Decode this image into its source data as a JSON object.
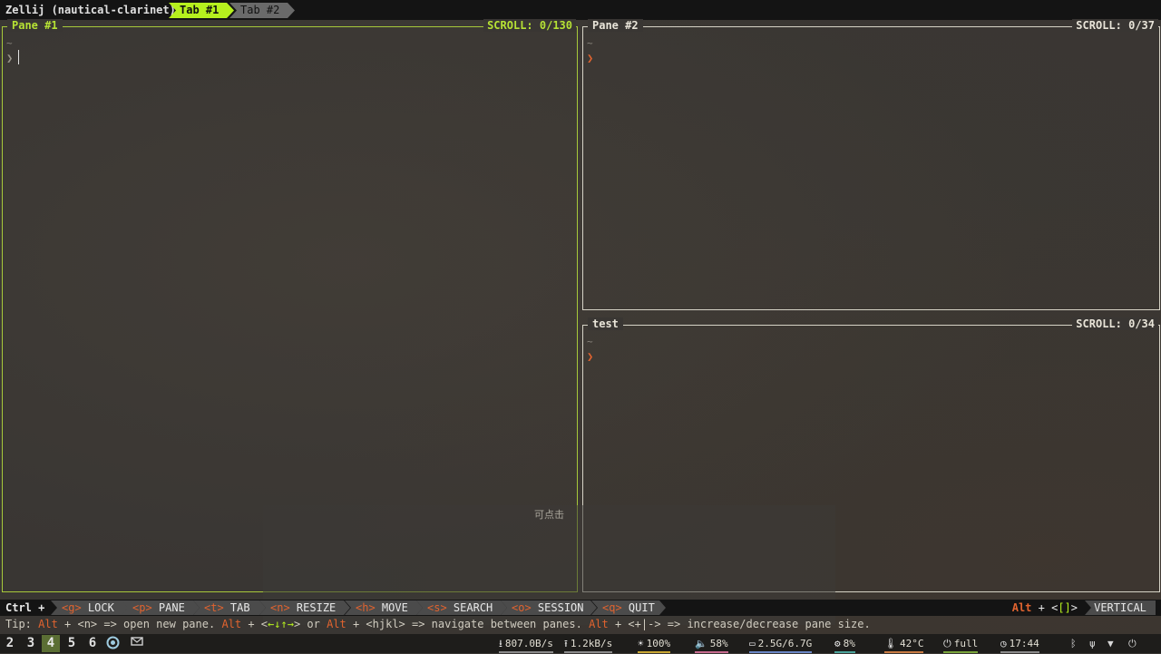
{
  "tabbar": {
    "session_title": "Zellij (nautical-clarinet)",
    "tabs": [
      {
        "label": "Tab #1",
        "active": true
      },
      {
        "label": "Tab #2",
        "active": false
      }
    ]
  },
  "panes": [
    {
      "title": "Pane #1",
      "scroll": "SCROLL:  0/130",
      "cwd": "~",
      "prompt": "❯",
      "focused": true
    },
    {
      "title": "Pane #2",
      "scroll": "SCROLL:  0/37",
      "cwd": "~",
      "prompt": "❯",
      "focused": false
    },
    {
      "title": "test",
      "scroll": "SCROLL:  0/34",
      "cwd": "~",
      "prompt": "❯",
      "focused": false
    }
  ],
  "overlay": {
    "label": "可点击"
  },
  "keybar": {
    "prefix": "Ctrl +",
    "items": [
      {
        "key": "<g>",
        "label": "LOCK"
      },
      {
        "key": "<p>",
        "label": "PANE"
      },
      {
        "key": "<t>",
        "label": "TAB"
      },
      {
        "key": "<n>",
        "label": "RESIZE"
      },
      {
        "key": "<h>",
        "label": "MOVE"
      },
      {
        "key": "<s>",
        "label": "SEARCH"
      },
      {
        "key": "<o>",
        "label": "SESSION"
      },
      {
        "key": "<q>",
        "label": "QUIT"
      }
    ],
    "right_alt": "Alt",
    "right_plus": " + <",
    "right_brackets": "[]",
    "right_close": ">",
    "mode": "VERTICAL"
  },
  "tip": {
    "p1": "Tip: ",
    "alt1": "Alt",
    "p2": " + <n> => open new pane. ",
    "alt2": "Alt",
    "p3": " + <",
    "arrows": "←↓↑→",
    "p4": "> or ",
    "alt3": "Alt",
    "p5": " + <hjkl> => navigate between panes. ",
    "alt4": "Alt",
    "p6": " + <+|-> => increase/decrease pane size."
  },
  "statusbar": {
    "workspaces": [
      "2",
      "3",
      "4",
      "5",
      "6"
    ],
    "active_workspace": "4",
    "download": "807.0B/s",
    "upload": "1.2kB/s",
    "brightness": "100%",
    "volume": "58%",
    "memory": "2.5G/6.7G",
    "cpu": "8%",
    "temperature": "42°C",
    "battery": "full",
    "clock": "17:44",
    "colors": {
      "accent": "#b6f01e",
      "highlight": "#e0632f",
      "pane_focus": "#a7c93a"
    }
  }
}
